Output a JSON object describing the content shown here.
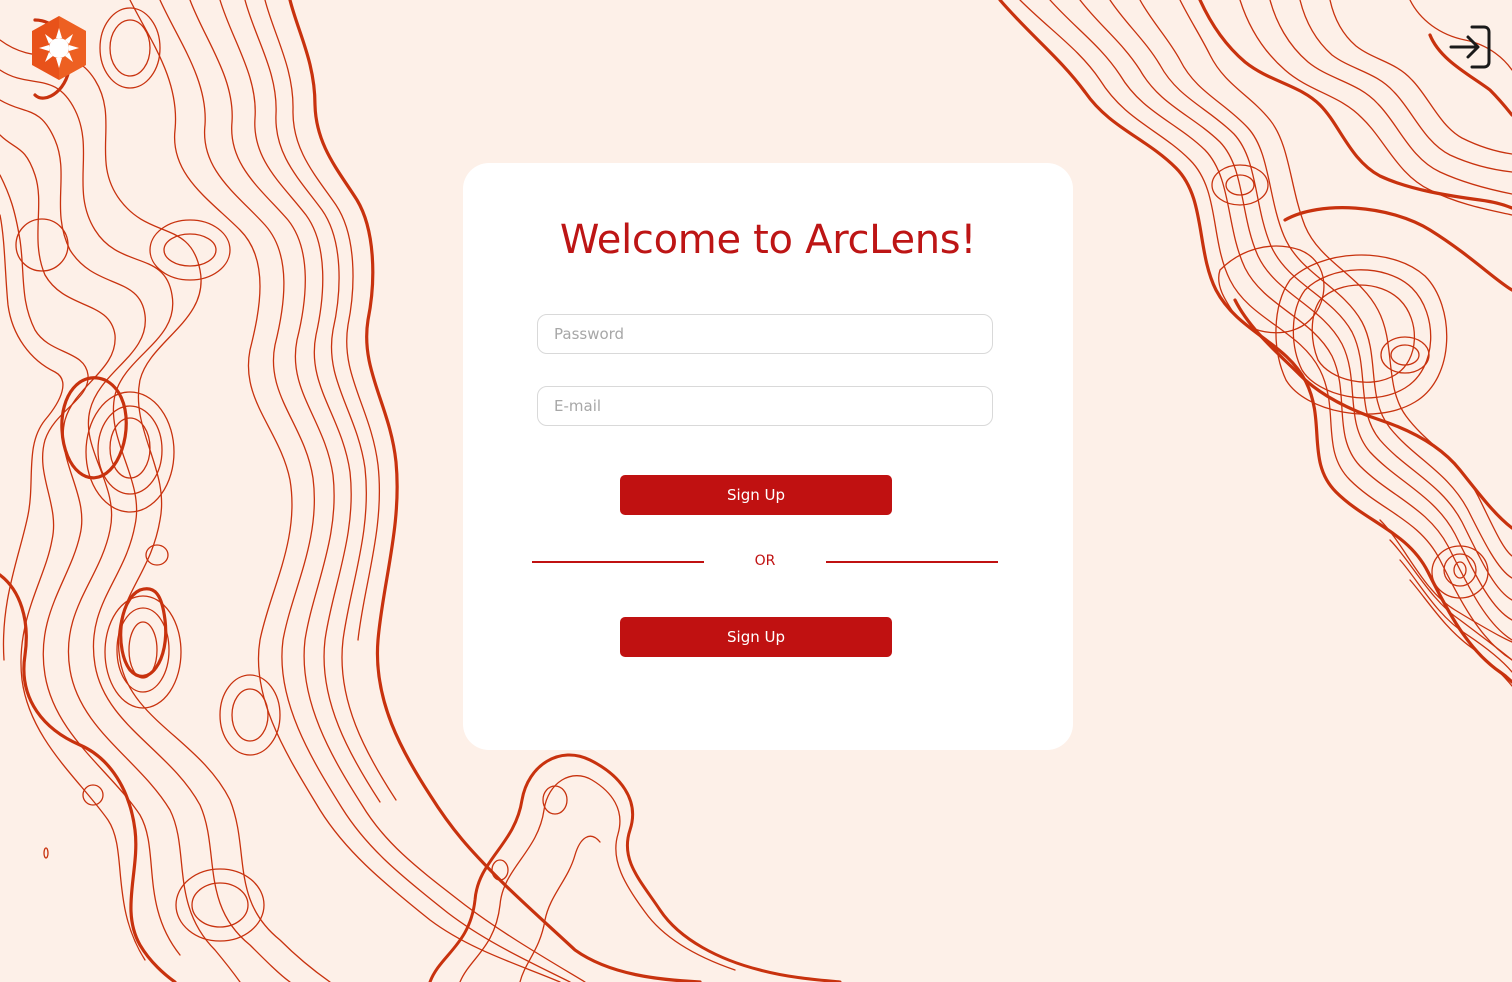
{
  "app": {
    "logo_icon": "sun-burst-logo-icon",
    "brand_color": "#e8521a",
    "accent_color": "#c01111",
    "background_color": "#fdf0e8",
    "contour_color": "#c8320e"
  },
  "header": {
    "login_icon": "login-arrow-icon"
  },
  "signup_card": {
    "title": "Welcome to ArcLens!",
    "password_field": {
      "placeholder": "Password",
      "value": ""
    },
    "email_field": {
      "placeholder": "E-mail",
      "value": ""
    },
    "primary_button_label": "Sign Up",
    "divider_text": "OR",
    "secondary_button_label": "Sign Up"
  }
}
